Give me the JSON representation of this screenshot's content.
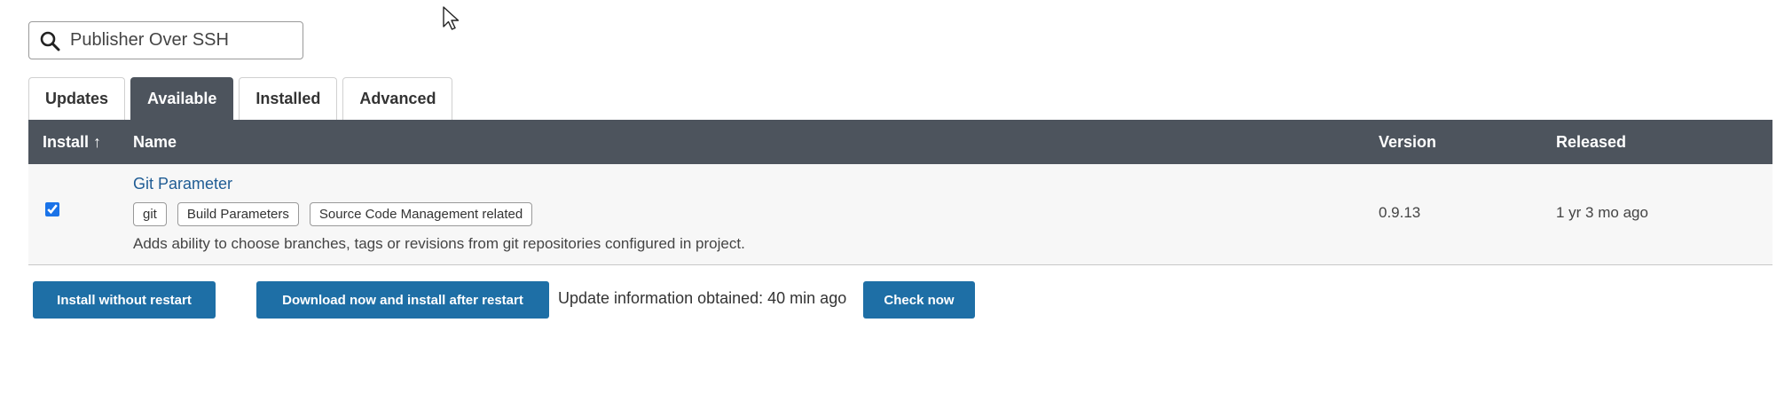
{
  "search": {
    "value": "Publisher Over SSH",
    "icon": "search-icon"
  },
  "tabs": [
    {
      "label": "Updates",
      "active": false
    },
    {
      "label": "Available",
      "active": true
    },
    {
      "label": "Installed",
      "active": false
    },
    {
      "label": "Advanced",
      "active": false
    }
  ],
  "table": {
    "headers": {
      "install": "Install ↑",
      "name": "Name",
      "version": "Version",
      "released": "Released"
    },
    "rows": [
      {
        "checked": true,
        "name": "Git Parameter",
        "tags": [
          "git",
          "Build Parameters",
          "Source Code Management related"
        ],
        "description": "Adds ability to choose branches, tags or revisions from git repositories configured in project.",
        "version": "0.9.13",
        "released": "1 yr 3 mo ago"
      }
    ]
  },
  "actions": {
    "install_without_restart": "Install without restart",
    "download_install_after_restart": "Download now and install after restart",
    "update_info": "Update information obtained: 40 min ago",
    "check_now": "Check now"
  },
  "colors": {
    "header_bg": "#4d545d",
    "button_bg": "#1e6fa6",
    "link": "#1f5c94",
    "row_bg": "#f7f7f7"
  }
}
